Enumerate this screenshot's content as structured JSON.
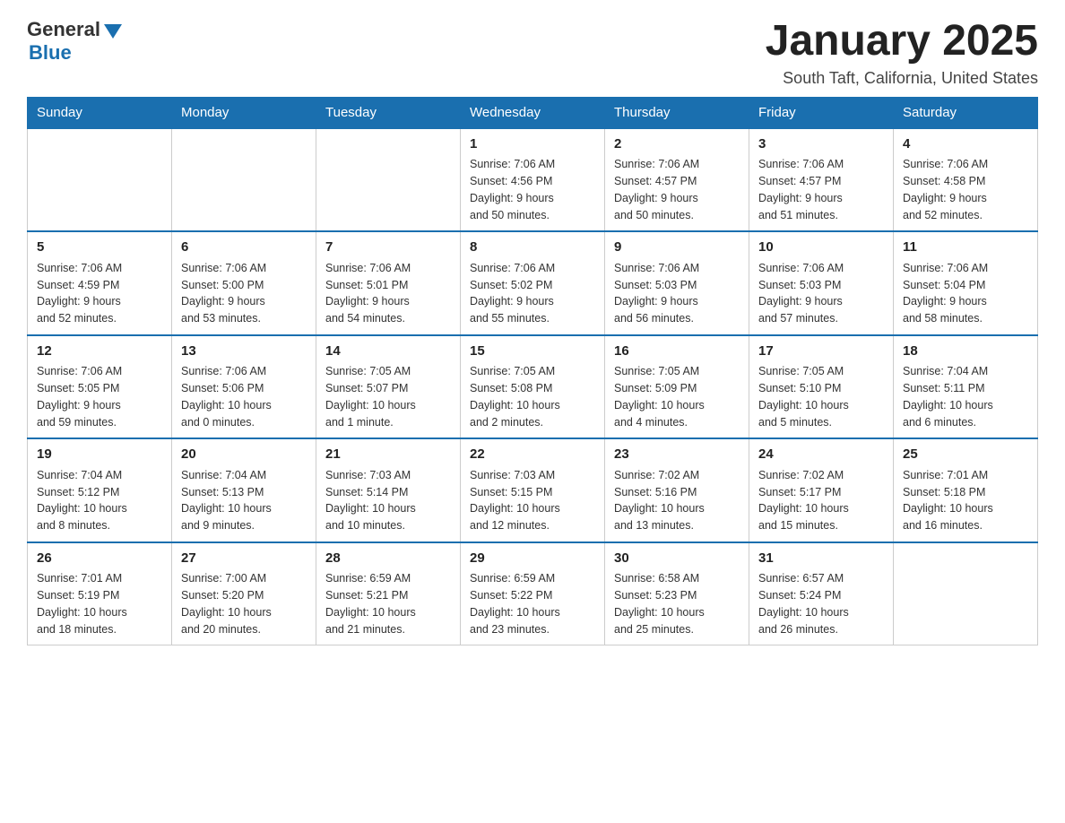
{
  "header": {
    "logo": {
      "general": "General",
      "blue": "Blue"
    },
    "title": "January 2025",
    "location": "South Taft, California, United States"
  },
  "weekdays": [
    "Sunday",
    "Monday",
    "Tuesday",
    "Wednesday",
    "Thursday",
    "Friday",
    "Saturday"
  ],
  "weeks": [
    [
      {
        "day": "",
        "info": ""
      },
      {
        "day": "",
        "info": ""
      },
      {
        "day": "",
        "info": ""
      },
      {
        "day": "1",
        "info": "Sunrise: 7:06 AM\nSunset: 4:56 PM\nDaylight: 9 hours\nand 50 minutes."
      },
      {
        "day": "2",
        "info": "Sunrise: 7:06 AM\nSunset: 4:57 PM\nDaylight: 9 hours\nand 50 minutes."
      },
      {
        "day": "3",
        "info": "Sunrise: 7:06 AM\nSunset: 4:57 PM\nDaylight: 9 hours\nand 51 minutes."
      },
      {
        "day": "4",
        "info": "Sunrise: 7:06 AM\nSunset: 4:58 PM\nDaylight: 9 hours\nand 52 minutes."
      }
    ],
    [
      {
        "day": "5",
        "info": "Sunrise: 7:06 AM\nSunset: 4:59 PM\nDaylight: 9 hours\nand 52 minutes."
      },
      {
        "day": "6",
        "info": "Sunrise: 7:06 AM\nSunset: 5:00 PM\nDaylight: 9 hours\nand 53 minutes."
      },
      {
        "day": "7",
        "info": "Sunrise: 7:06 AM\nSunset: 5:01 PM\nDaylight: 9 hours\nand 54 minutes."
      },
      {
        "day": "8",
        "info": "Sunrise: 7:06 AM\nSunset: 5:02 PM\nDaylight: 9 hours\nand 55 minutes."
      },
      {
        "day": "9",
        "info": "Sunrise: 7:06 AM\nSunset: 5:03 PM\nDaylight: 9 hours\nand 56 minutes."
      },
      {
        "day": "10",
        "info": "Sunrise: 7:06 AM\nSunset: 5:03 PM\nDaylight: 9 hours\nand 57 minutes."
      },
      {
        "day": "11",
        "info": "Sunrise: 7:06 AM\nSunset: 5:04 PM\nDaylight: 9 hours\nand 58 minutes."
      }
    ],
    [
      {
        "day": "12",
        "info": "Sunrise: 7:06 AM\nSunset: 5:05 PM\nDaylight: 9 hours\nand 59 minutes."
      },
      {
        "day": "13",
        "info": "Sunrise: 7:06 AM\nSunset: 5:06 PM\nDaylight: 10 hours\nand 0 minutes."
      },
      {
        "day": "14",
        "info": "Sunrise: 7:05 AM\nSunset: 5:07 PM\nDaylight: 10 hours\nand 1 minute."
      },
      {
        "day": "15",
        "info": "Sunrise: 7:05 AM\nSunset: 5:08 PM\nDaylight: 10 hours\nand 2 minutes."
      },
      {
        "day": "16",
        "info": "Sunrise: 7:05 AM\nSunset: 5:09 PM\nDaylight: 10 hours\nand 4 minutes."
      },
      {
        "day": "17",
        "info": "Sunrise: 7:05 AM\nSunset: 5:10 PM\nDaylight: 10 hours\nand 5 minutes."
      },
      {
        "day": "18",
        "info": "Sunrise: 7:04 AM\nSunset: 5:11 PM\nDaylight: 10 hours\nand 6 minutes."
      }
    ],
    [
      {
        "day": "19",
        "info": "Sunrise: 7:04 AM\nSunset: 5:12 PM\nDaylight: 10 hours\nand 8 minutes."
      },
      {
        "day": "20",
        "info": "Sunrise: 7:04 AM\nSunset: 5:13 PM\nDaylight: 10 hours\nand 9 minutes."
      },
      {
        "day": "21",
        "info": "Sunrise: 7:03 AM\nSunset: 5:14 PM\nDaylight: 10 hours\nand 10 minutes."
      },
      {
        "day": "22",
        "info": "Sunrise: 7:03 AM\nSunset: 5:15 PM\nDaylight: 10 hours\nand 12 minutes."
      },
      {
        "day": "23",
        "info": "Sunrise: 7:02 AM\nSunset: 5:16 PM\nDaylight: 10 hours\nand 13 minutes."
      },
      {
        "day": "24",
        "info": "Sunrise: 7:02 AM\nSunset: 5:17 PM\nDaylight: 10 hours\nand 15 minutes."
      },
      {
        "day": "25",
        "info": "Sunrise: 7:01 AM\nSunset: 5:18 PM\nDaylight: 10 hours\nand 16 minutes."
      }
    ],
    [
      {
        "day": "26",
        "info": "Sunrise: 7:01 AM\nSunset: 5:19 PM\nDaylight: 10 hours\nand 18 minutes."
      },
      {
        "day": "27",
        "info": "Sunrise: 7:00 AM\nSunset: 5:20 PM\nDaylight: 10 hours\nand 20 minutes."
      },
      {
        "day": "28",
        "info": "Sunrise: 6:59 AM\nSunset: 5:21 PM\nDaylight: 10 hours\nand 21 minutes."
      },
      {
        "day": "29",
        "info": "Sunrise: 6:59 AM\nSunset: 5:22 PM\nDaylight: 10 hours\nand 23 minutes."
      },
      {
        "day": "30",
        "info": "Sunrise: 6:58 AM\nSunset: 5:23 PM\nDaylight: 10 hours\nand 25 minutes."
      },
      {
        "day": "31",
        "info": "Sunrise: 6:57 AM\nSunset: 5:24 PM\nDaylight: 10 hours\nand 26 minutes."
      },
      {
        "day": "",
        "info": ""
      }
    ]
  ]
}
